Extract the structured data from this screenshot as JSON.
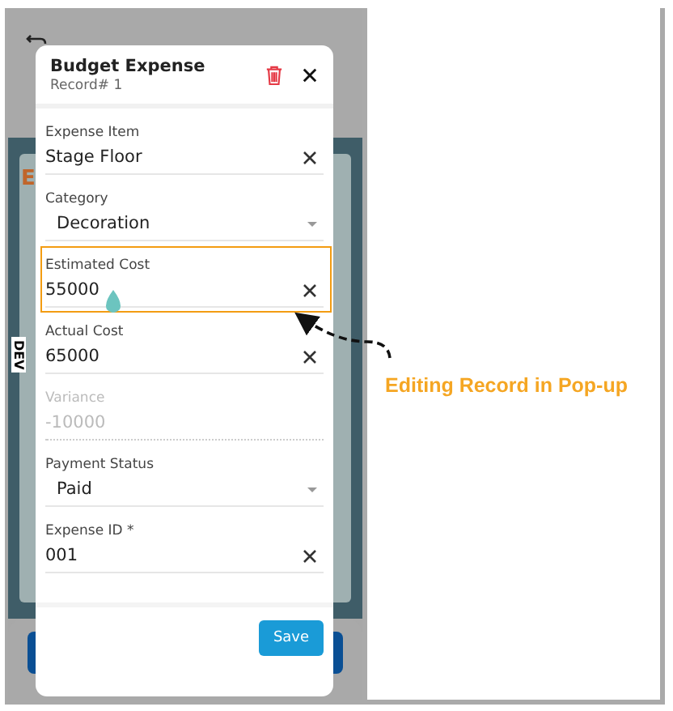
{
  "background_app": {
    "heading": "E",
    "tag": "DEV"
  },
  "dialog": {
    "title": "Budget Expense",
    "subtitle": "Record# 1",
    "fields": [
      {
        "kind": "text",
        "label": "Expense Item",
        "value": "Stage Floor",
        "disabled": false,
        "highlighted": false
      },
      {
        "kind": "select",
        "label": "Category",
        "value": "Decoration",
        "disabled": false,
        "highlighted": false
      },
      {
        "kind": "text",
        "label": "Estimated Cost",
        "value": "55000",
        "disabled": false,
        "highlighted": true
      },
      {
        "kind": "text",
        "label": "Actual Cost",
        "value": "65000",
        "disabled": false,
        "highlighted": false
      },
      {
        "kind": "readonly",
        "label": "Variance",
        "value": "-10000",
        "disabled": true,
        "highlighted": false
      },
      {
        "kind": "select",
        "label": "Payment Status",
        "value": "Paid",
        "disabled": false,
        "highlighted": false
      },
      {
        "kind": "text",
        "label": "Expense ID *",
        "value": "001",
        "disabled": false,
        "highlighted": false
      }
    ],
    "save_button": "Save"
  },
  "annotation": {
    "label": "Editing Record in Pop-up"
  }
}
